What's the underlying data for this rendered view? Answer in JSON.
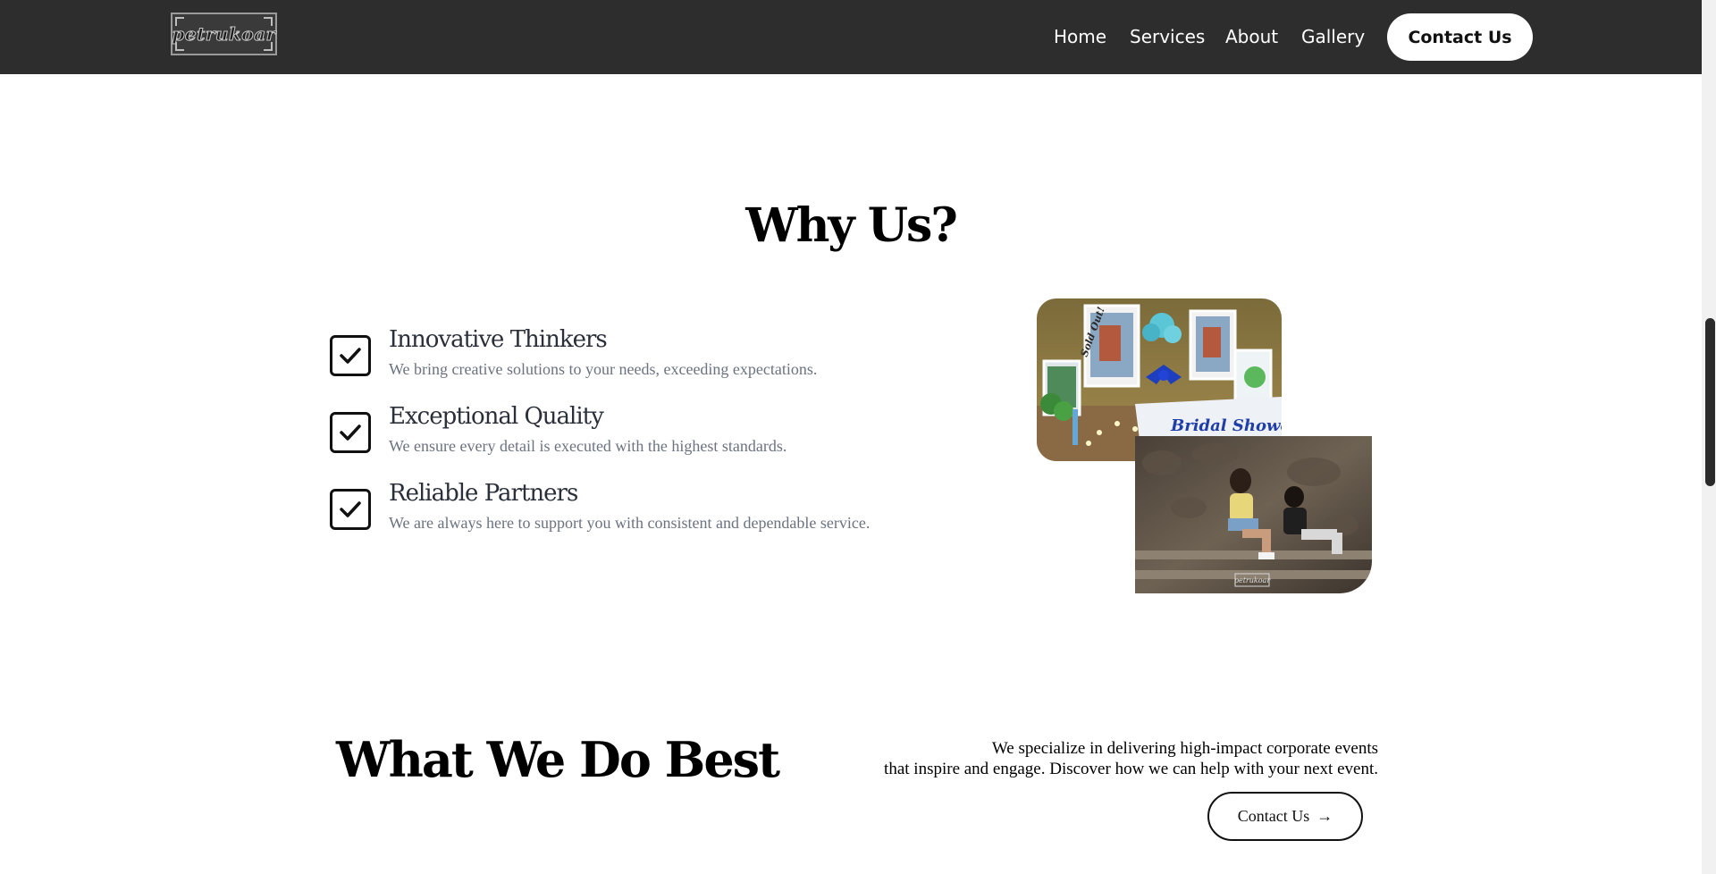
{
  "nav": {
    "logo_text": "petrukoar",
    "links": [
      "Home",
      "Services",
      "About",
      "Gallery"
    ],
    "contact_label": "Contact Us"
  },
  "why_us": {
    "title": "Why Us?",
    "features": [
      {
        "title": "Innovative Thinkers",
        "description": "We bring creative solutions to your needs, exceeding expectations."
      },
      {
        "title": "Exceptional Quality",
        "description": "We ensure every detail is executed with the highest standards."
      },
      {
        "title": "Reliable Partners",
        "description": "We are always here to support you with consistent and dependable service."
      }
    ],
    "photo1_caption": "Bridal Shower",
    "photo1_sign": "Sold Out!",
    "photo2_watermark": "petrukoar"
  },
  "what_we_do": {
    "title": "What We Do Best",
    "text_line1": "We specialize in delivering high-impact corporate events",
    "text_line2": "that inspire and engage. Discover how we can help with your next event.",
    "button_label": "Contact Us",
    "button_arrow": "→"
  }
}
